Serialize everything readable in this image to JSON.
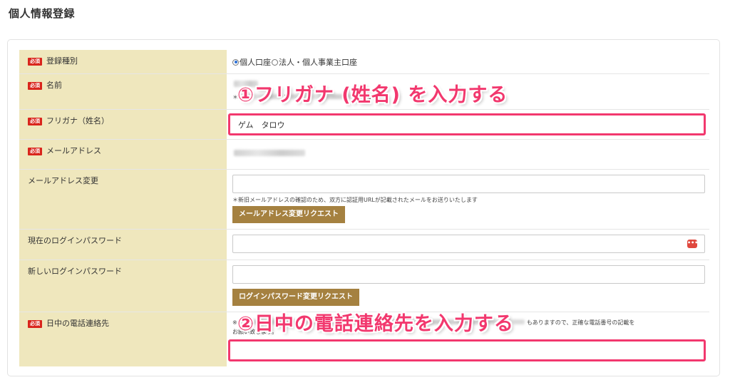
{
  "page": {
    "title": "個人情報登録"
  },
  "required_badge": "必須",
  "rows": {
    "type": {
      "label": "登録種別",
      "options": [
        "個人口座",
        "法人・個人事業主口座"
      ],
      "selected": 0
    },
    "name": {
      "label": "名前",
      "note_prefix": "＊",
      "note_middle": "は",
      "note_end": "下さい"
    },
    "furigana": {
      "label": "フリガナ（姓名）",
      "value": "ゲム　タロウ"
    },
    "email": {
      "label": "メールアドレス"
    },
    "email_change": {
      "label": "メールアドレス変更",
      "value": "",
      "note": "＊新旧メールアドレスの確認のため、双方に認証用URLが記載されたメールをお送りいたします",
      "button": "メールアドレス変更リクエスト"
    },
    "current_password": {
      "label": "現在のログインパスワード",
      "value": "",
      "icon": "password-manager-icon"
    },
    "new_password": {
      "label": "新しいログインパスワード",
      "value": "",
      "button": "ログインパスワード変更リクエスト"
    },
    "phone": {
      "label": "日中の電話連絡先",
      "note_start": "※",
      "note_tail": "もありますので、正確な電話番号の記載を",
      "note_line2": "お願い致します。",
      "value": ""
    }
  },
  "annotations": {
    "step1": "①フリガナ (姓名) を入力する",
    "step2": "②日中の電話連絡先を入力する",
    "color": "#f2386e"
  },
  "colors": {
    "label_bg": "#efe7bd",
    "button_bg": "#a58140",
    "required_bg": "#d9251c"
  }
}
